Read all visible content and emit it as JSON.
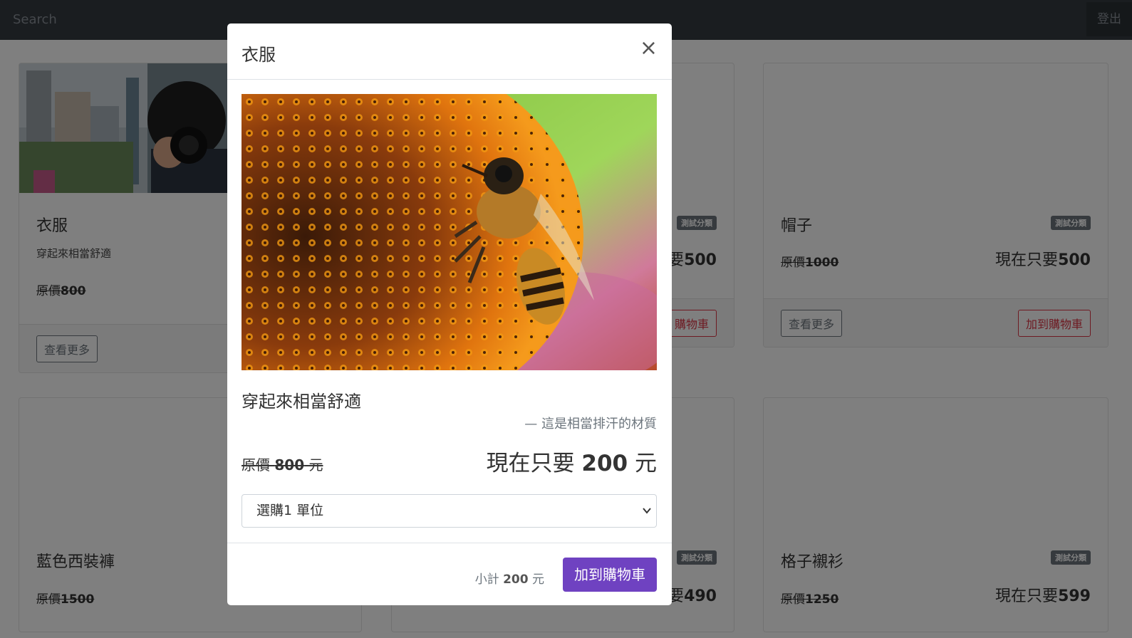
{
  "nav": {
    "search_placeholder": "Search",
    "logout": "登出"
  },
  "products": [
    {
      "title": "衣服",
      "desc": "穿起來相當舒適",
      "orig_label": "原價",
      "orig_price": "800",
      "more": "查看更多"
    },
    {
      "badge": "測試分類",
      "now_label": "要",
      "now_price": "500",
      "cart_partial": "購物車"
    },
    {
      "title": "帽子",
      "badge": "測試分類",
      "orig_label": "原價",
      "orig_price": "1000",
      "now_label": "現在只要",
      "now_price": "500",
      "more": "查看更多",
      "cart": "加到購物車"
    },
    {
      "title": "藍色西裝褲",
      "orig_label": "原價",
      "orig_price": "1500"
    },
    {
      "badge": "測試分類",
      "now_label": "要",
      "now_price": "490"
    },
    {
      "title": "格子襯衫",
      "badge": "測試分類",
      "orig_label": "原價",
      "orig_price": "1250",
      "now_label": "現在只要",
      "now_price": "599"
    }
  ],
  "modal": {
    "title": "衣服",
    "close": "×",
    "subtitle": "穿起來相當舒適",
    "quote": "— 這是相當排汗的材質",
    "orig_label": "原價",
    "orig_price": "800",
    "orig_unit": "元",
    "now_label": "現在只要",
    "now_price": "200",
    "now_unit": "元",
    "qty_selected": "選購1 單位",
    "subtotal_label": "小計",
    "subtotal_value": "200",
    "subtotal_unit": "元",
    "add_button": "加到購物車"
  },
  "colors": {
    "primary": "#6f42c1",
    "danger": "#dc3545",
    "navbar": "#343a40"
  }
}
